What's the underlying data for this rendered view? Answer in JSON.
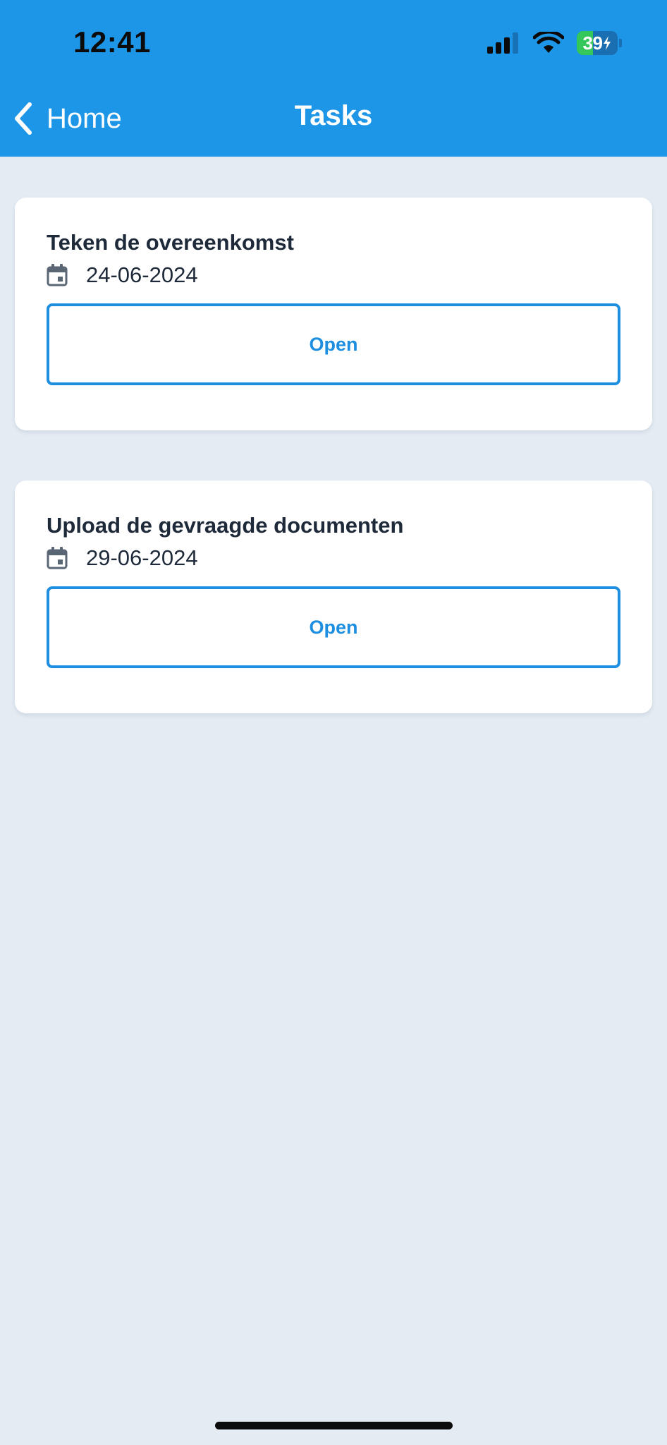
{
  "status_bar": {
    "time": "12:41",
    "battery_level": "39",
    "icons": [
      "signal-icon",
      "wifi-icon",
      "battery-charging-icon"
    ]
  },
  "nav": {
    "back_label": "Home",
    "title": "Tasks"
  },
  "tasks": [
    {
      "title": "Teken de overeenkomst",
      "date": "24-06-2024",
      "button_label": "Open"
    },
    {
      "title": "Upload de gevraagde documenten",
      "date": "29-06-2024",
      "button_label": "Open"
    }
  ],
  "colors": {
    "header": "#1e96e8",
    "background": "#e4ebf3",
    "accent": "#1e8fe0",
    "text": "#1e2a3a"
  }
}
